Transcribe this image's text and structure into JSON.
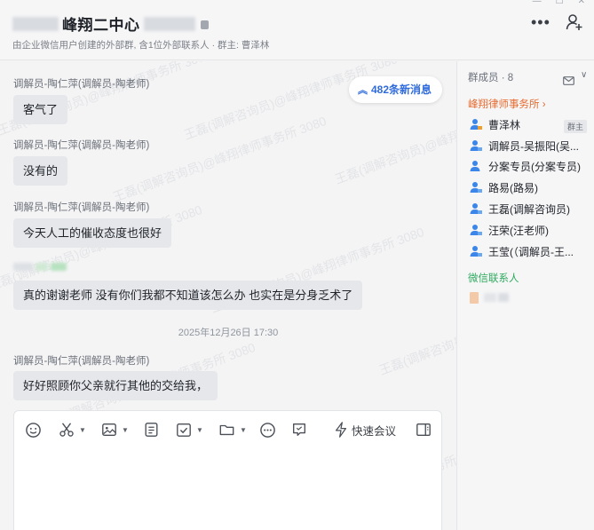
{
  "header": {
    "title": "峰翔二中心",
    "subtitle": "由企业微信用户创建的外部群, 含1位外部联系人 · 群主: 曹泽林"
  },
  "chat": {
    "new_messages_label": "482条新消息",
    "watermark_text": "王磊(调解咨询员)@峰翔律师事务所 3080",
    "messages": [
      {
        "sender": "调解员-陶仁萍(调解员-陶老师)",
        "text": "客气了"
      },
      {
        "sender": "调解员-陶仁萍(调解员-陶老师)",
        "text": "没有的"
      },
      {
        "sender": "调解员-陶仁萍(调解员-陶老师)",
        "text": "今天人工的催收态度也很好"
      },
      {
        "sender": "",
        "text": "真的谢谢老师 没有你们我都不知道该怎么办 也实在是分身乏术了"
      },
      {
        "sender": "调解员-陶仁萍(调解员-陶老师)",
        "text": "好好照顾你父亲就行其他的交给我，"
      }
    ],
    "timestamp": "2025年12月26日 17:30"
  },
  "composer": {
    "quick_meeting_label": "快速会议"
  },
  "sidebar": {
    "members_label": "群成员 · 8",
    "org_label": "峰翔律师事务所",
    "members": [
      {
        "name": "曹泽林",
        "badge": "群主"
      },
      {
        "name": "调解员-吴振阳(吴..."
      },
      {
        "name": "分案专员(分案专员)"
      },
      {
        "name": "路易(路易)"
      },
      {
        "name": "王磊(调解咨询员)"
      },
      {
        "name": "汪荣(汪老师)"
      },
      {
        "name": "王莹(（调解员-王..."
      }
    ],
    "wechat_label": "微信联系人"
  },
  "colors": {
    "accent_blue": "#2f6bdc",
    "org_orange": "#e66b2f",
    "wechat_green": "#2eaa5e",
    "bubble_gray": "#e6e7ea"
  },
  "icons": [
    "more-icon",
    "add-member-icon",
    "lock-icon",
    "double-chevron-up-icon",
    "emoji-icon",
    "scissors-icon",
    "image-icon",
    "document-icon",
    "task-icon",
    "folder-icon",
    "more-circle-icon",
    "comment-icon",
    "lightning-icon",
    "sidebar-toggle-icon",
    "mail-icon",
    "user-icon"
  ]
}
